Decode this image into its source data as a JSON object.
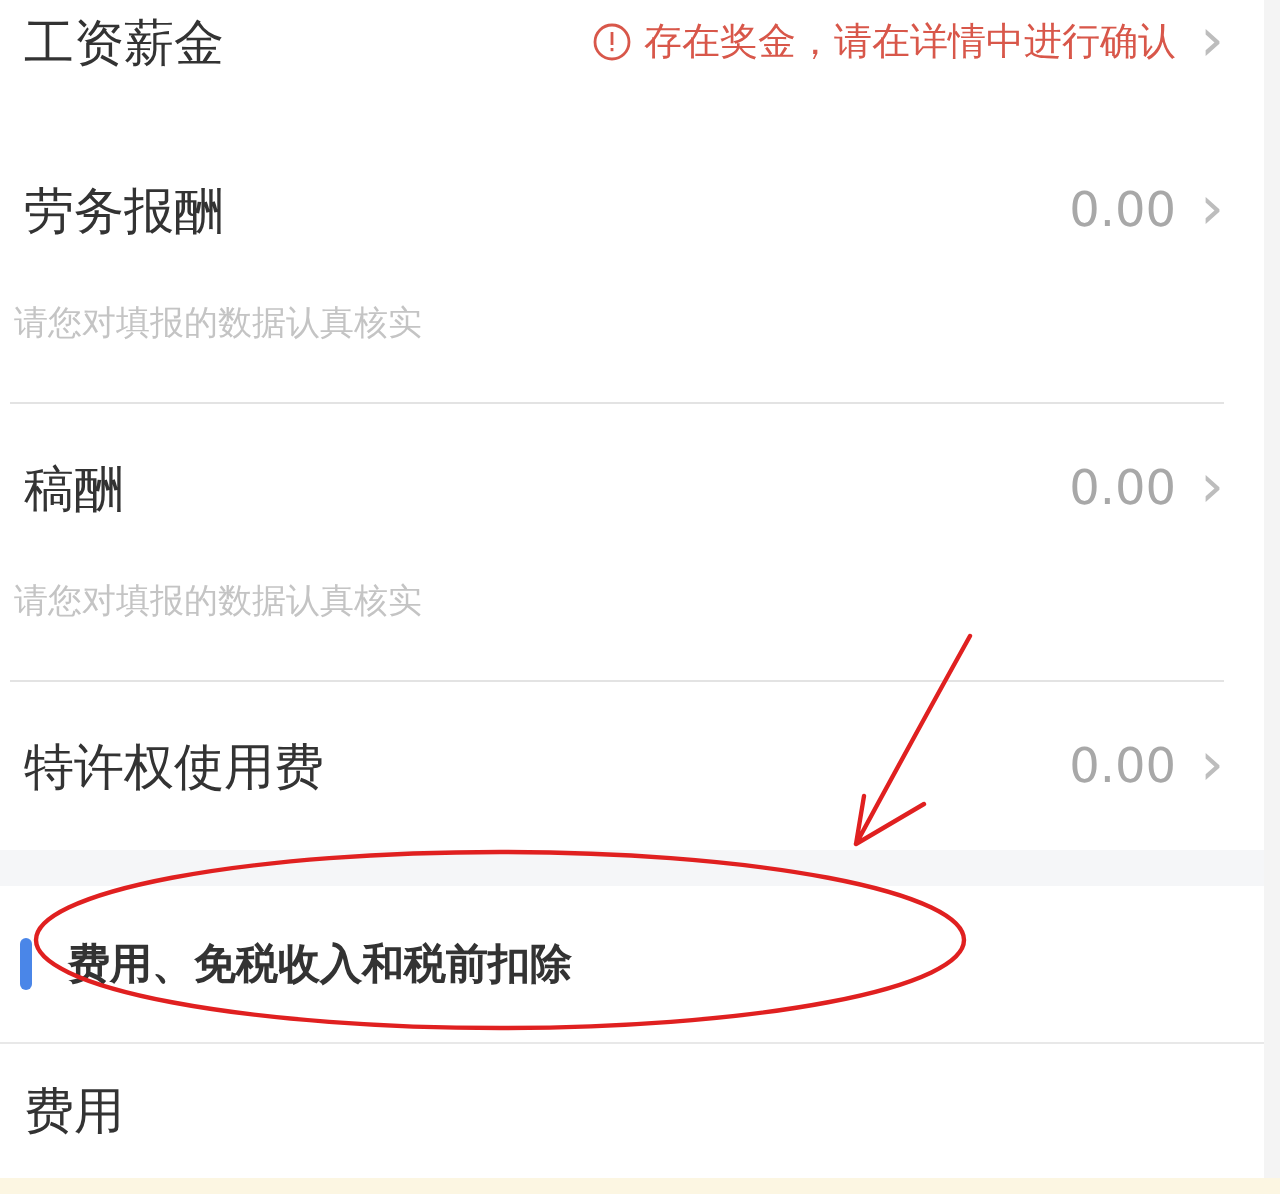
{
  "income_items": [
    {
      "kind": "alert",
      "label": "工资薪金",
      "alert": "存在奖金，请在详情中进行确认",
      "chevron": "›"
    },
    {
      "kind": "amount",
      "label": "劳务报酬",
      "amount": "0.00",
      "chevron": "›",
      "note": "请您对填报的数据认真核实"
    },
    {
      "kind": "amount",
      "label": "稿酬",
      "amount": "0.00",
      "chevron": "›",
      "note": "请您对填报的数据认真核实"
    },
    {
      "kind": "amount",
      "label": "特许权使用费",
      "amount": "0.00",
      "chevron": "›"
    }
  ],
  "section": {
    "title": "费用、免税收入和税前扣除",
    "items": [
      {
        "kind": "plain",
        "label": "费用"
      }
    ]
  },
  "annotation_arrow": {
    "color": "#e02020"
  },
  "annotation_ellipse": {
    "color": "#e02020"
  }
}
